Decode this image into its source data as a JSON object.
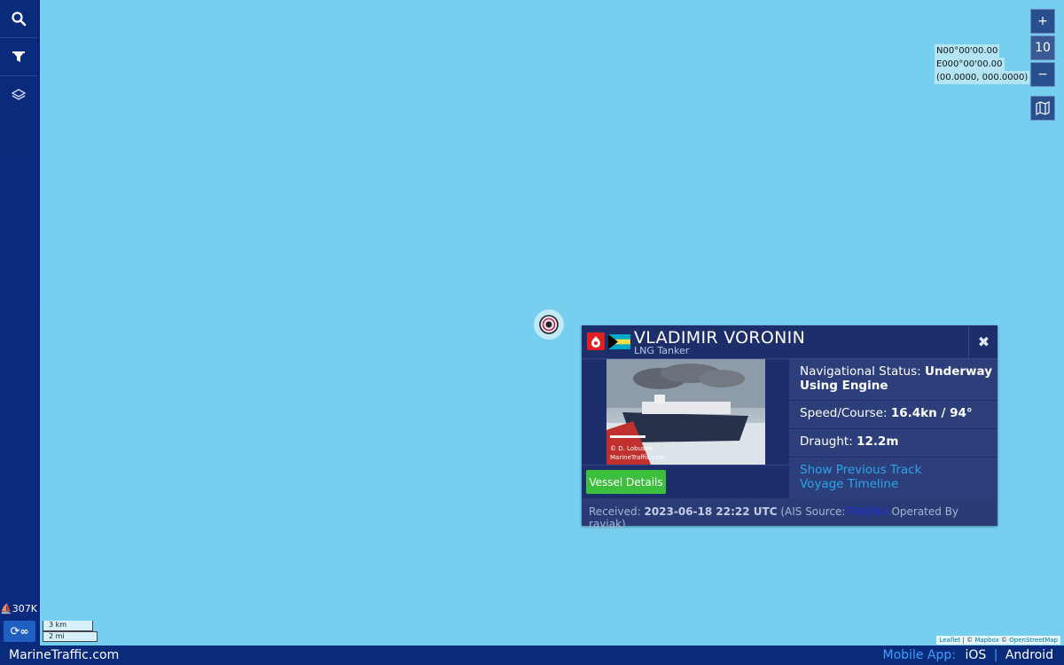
{
  "sidebar": {
    "vessel_count": "307K",
    "loop_label": "∞"
  },
  "scale": {
    "km": "3 km",
    "mi": "2 mi"
  },
  "zoom": {
    "in_label": "+",
    "level": "10",
    "out_label": "−"
  },
  "coordinates": {
    "lat": "N00°00'00.00",
    "lon": "E000°00'00.00",
    "decimal": "(00.0000, 000.0000)"
  },
  "vessel": {
    "name": "VLADIMIR VORONIN",
    "type": "LNG Tanker",
    "photo_credit_1": "© D. Lobusov",
    "photo_credit_2": "MarineTraffic.com",
    "nav_status_label": "Navigational Status: ",
    "nav_status_value": "Underway Using Engine",
    "speed_label": "Speed/Course: ",
    "speed_value": "16.4kn / 94°",
    "draught_label": "Draught: ",
    "draught_value": "12.2m",
    "show_track": "Show Previous Track",
    "voyage_timeline": "Voyage Timeline",
    "details_button": "Vessel Details",
    "received_label": "Received: ",
    "received_value": "2023-06-18 22:22 UTC",
    "ais_source_label": " (AIS Source:",
    "ais_source_value": "TRAENA",
    "operated_by": " Operated By rayjak)",
    "close_label": "✖"
  },
  "footer": {
    "brand": "MarineTraffic.com",
    "mobile_label": "Mobile App:",
    "ios": "iOS",
    "separator": "|",
    "android": "Android"
  },
  "attribution": {
    "leaflet": "Leaflet",
    "sep1": " | © ",
    "mapbox": "Mapbox",
    "sep2": " © ",
    "osm": "OpenStreetMap"
  },
  "colors": {
    "sea": "#76cfef",
    "sidebar": "#0a2a7a",
    "popup": "#1c2f6a",
    "accent_green": "#3cbf3c",
    "link_blue": "#2ba4e8",
    "type_icon_red": "#e02020"
  },
  "icons": [
    "search-icon",
    "filter-icon",
    "layers-icon",
    "map-icon",
    "close-icon",
    "gas-tanker-icon",
    "bahamas-flag-icon",
    "vessel-marker-icon"
  ]
}
